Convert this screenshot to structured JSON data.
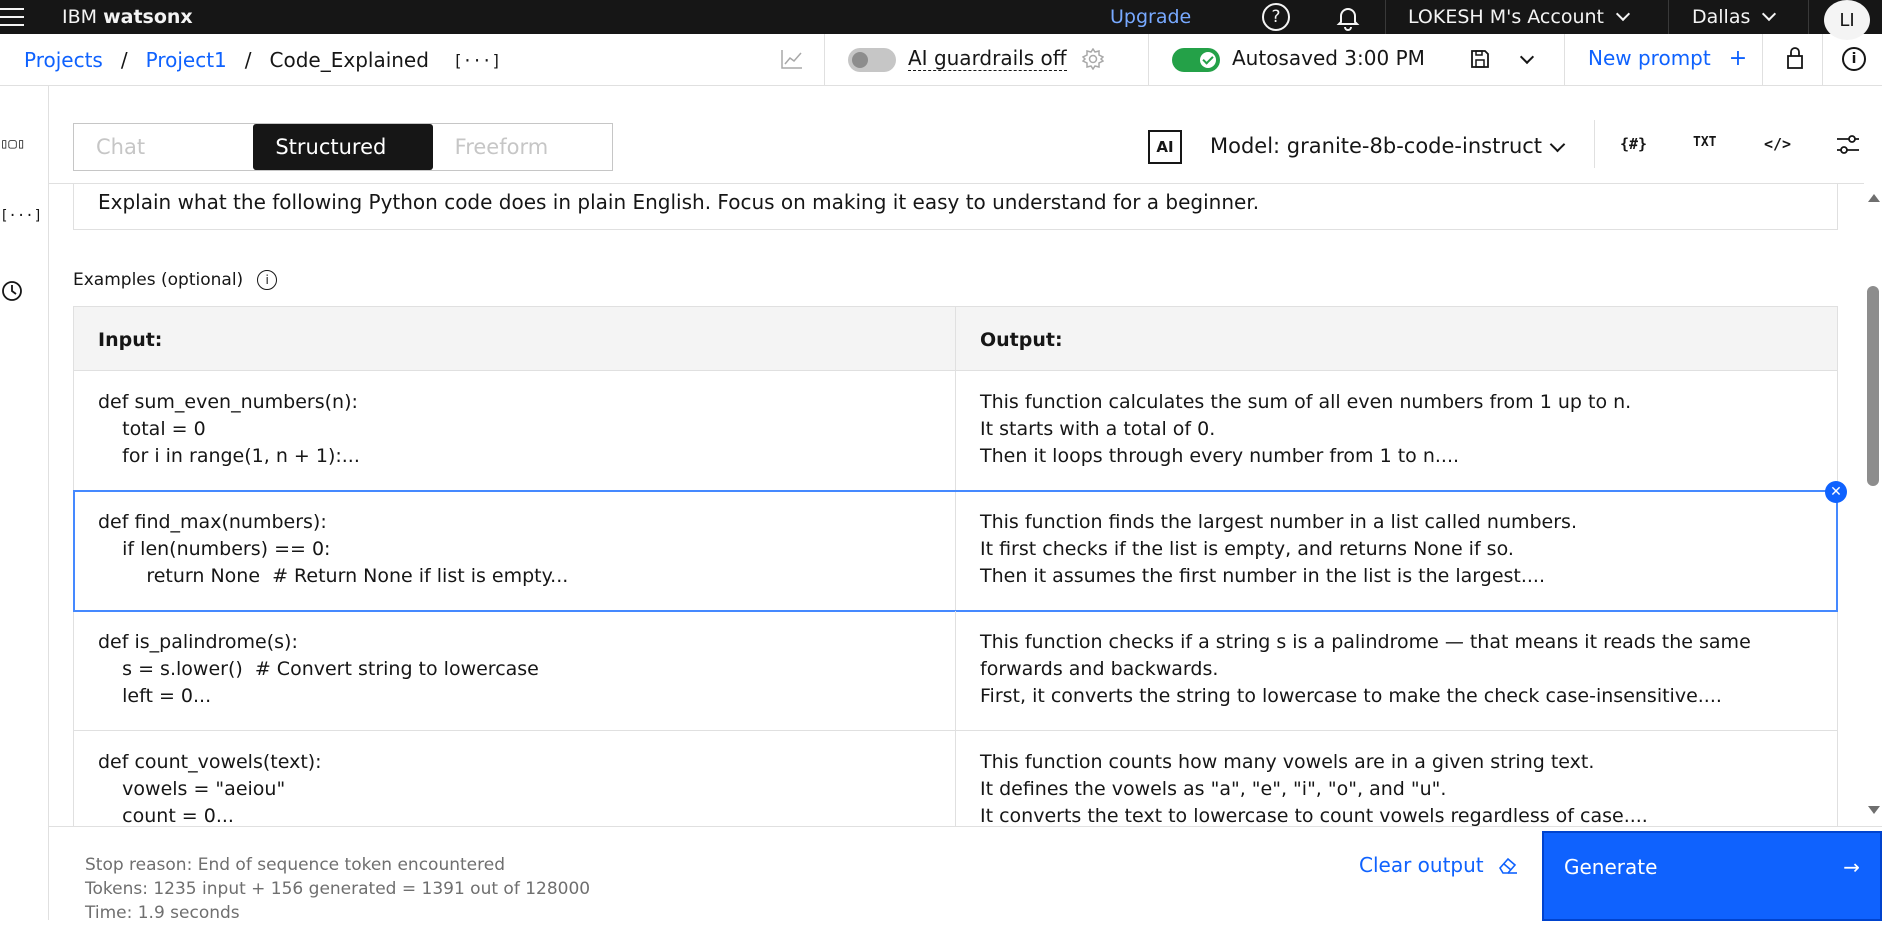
{
  "header": {
    "brand_prefix": "IBM",
    "brand_product": "watsonx",
    "upgrade": "Upgrade",
    "account": "LOKESH M's Account",
    "region": "Dallas",
    "avatar_initials": "LI"
  },
  "breadcrumb": {
    "items": [
      "Projects",
      "Project1",
      "Code_Explained"
    ],
    "separator": "/",
    "variables_glyph": "[···]"
  },
  "toolbar": {
    "guardrails_label": "AI guardrails off",
    "guardrails_on": false,
    "autosaved_label": "Autosaved 3:00 PM",
    "autosave_on": true,
    "new_prompt": "New prompt",
    "new_prompt_glyph": "+"
  },
  "modes": {
    "items": [
      "Chat",
      "Structured",
      "Freeform"
    ],
    "active": "Structured"
  },
  "model": {
    "badge": "AI",
    "label": "Model: granite-8b-code-instruct",
    "tools": [
      "{#}",
      "TXT",
      "</>"
    ]
  },
  "rail": {
    "glyphs": [
      "▯▢▯",
      "[···]"
    ]
  },
  "instruction": "Explain what the following Python code does in plain English. Focus on making it easy to understand for a beginner.",
  "examples": {
    "label": "Examples (optional)",
    "input_header": "Input:",
    "output_header": "Output:",
    "rows": [
      {
        "input": "def sum_even_numbers(n):\n    total = 0\n    for i in range(1, n + 1):...",
        "output": [
          "This function calculates the sum of all even numbers from 1 up to n.",
          "It starts with a total of 0.",
          "Then it loops through every number from 1 to n...."
        ]
      },
      {
        "input": "def find_max(numbers):\n    if len(numbers) == 0:\n        return None  # Return None if list is empty...",
        "output": [
          "This function finds the largest number in a list called numbers.",
          "It first checks if the list is empty, and returns None if so.",
          "Then it assumes the first number in the list is the largest...."
        ],
        "selected": true
      },
      {
        "input": "def is_palindrome(s):\n    s = s.lower()  # Convert string to lowercase\n    left = 0...",
        "output": [
          "This function checks if a string s is a palindrome — that means it reads the same forwards and backwards.",
          "First, it converts the string to lowercase to make the check case-insensitive...."
        ]
      },
      {
        "input": "def count_vowels(text):\n    vowels = \"aeiou\"\n    count = 0...",
        "output": [
          "This function counts how many vowels are in a given string text.",
          "It defines the vowels as \"a\", \"e\", \"i\", \"o\", and \"u\".",
          "It converts the text to lowercase to count vowels regardless of case...."
        ]
      }
    ]
  },
  "footer": {
    "stop_reason": "Stop reason: End of sequence token encountered",
    "tokens": "Tokens: 1235 input + 156 generated = 1391 out of 128000",
    "time": "Time: 1.9 seconds",
    "clear_output": "Clear output",
    "generate": "Generate",
    "generate_glyph": "→"
  },
  "colors": {
    "accent": "#0f62fe",
    "header_bg": "#161616",
    "toggle_on": "#24a148"
  }
}
